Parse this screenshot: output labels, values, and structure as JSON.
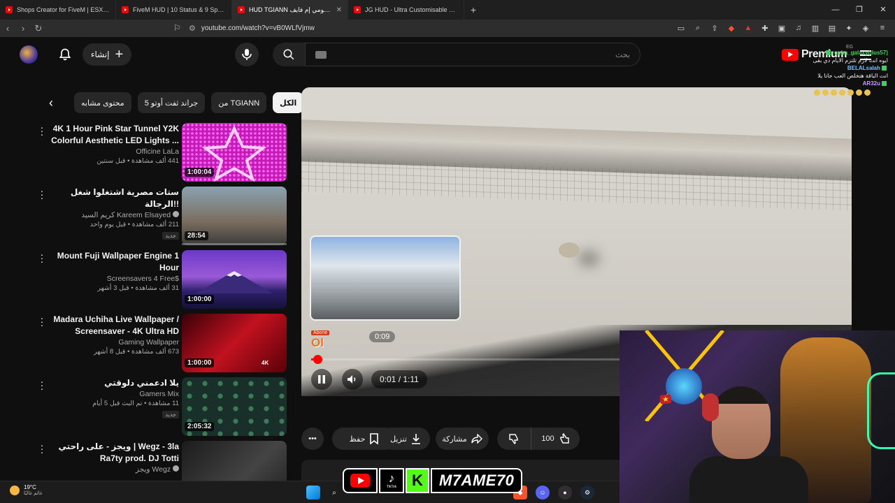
{
  "browser": {
    "tabs": [
      {
        "title": "Shops Creator for FiveM | ESX, Qbox..."
      },
      {
        "title": "FiveM HUD | 10 Status & 9 Speed..."
      },
      {
        "title": "HUD TGIANN لومي إم فايف - YouTube"
      },
      {
        "title": "JG HUD - Ultra Customisable & Vehic..."
      }
    ],
    "url": "youtube.com/watch?v=vB0WLfVjmw"
  },
  "header": {
    "create_label": "إنشاء",
    "search_placeholder": "بحث",
    "logo_word": "Premium",
    "region": "EG"
  },
  "chat": [
    {
      "name": "rouba_galaxy(dus57)",
      "msg": "",
      "color": "#3bd35a"
    },
    {
      "name": "",
      "msg": "ايوه انت لازم تلتزم الايام دي بقى",
      "color": "#ffffff"
    },
    {
      "name": "BELALsalah",
      "msg": "",
      "color": "#6ec1ff"
    },
    {
      "name": "",
      "msg": "انت الباقة هتخلص العب جاتا يلا",
      "color": "#ffffff"
    },
    {
      "name": "AR32u",
      "msg": "",
      "color": "#c59cff"
    }
  ],
  "chips": [
    "محتوى مشابه",
    "جراند ثفت أوتو 5",
    "من TGIANN",
    "الكل"
  ],
  "videos": [
    {
      "title": "4K 1 Hour Pink Star Tunnel Y2K Colorful Aesthetic LED Lights ...",
      "channel": "Officine LaLa",
      "stats": "441 ألف مشاهدة • قبل سنتين",
      "duration": "1:00:04",
      "badge": ""
    },
    {
      "title": "ستات مصرية اشتغلوا شغل الرجالة!!",
      "channel": "كريم السيد Kareem Elsayed",
      "stats": "211 ألف مشاهدة • قبل يوم واحد",
      "duration": "28:54",
      "badge": "جديد"
    },
    {
      "title": "Mount Fuji Wallpaper Engine 1 Hour",
      "channel": "Screensavers 4 Free$",
      "stats": "31 ألف مشاهدة • قبل 3 أشهر",
      "duration": "1:00:00",
      "badge": ""
    },
    {
      "title": "Madara Uchiha Live Wallpaper / Screensaver - 4K Ultra HD",
      "channel": "Gaming Wallpaper",
      "stats": "673 ألف مشاهدة • قبل 8 أشهر",
      "duration": "1:00:00",
      "badge": "",
      "quality": "4K"
    },
    {
      "title": "يلا ادعمني دلوقتي",
      "channel": "Gamers Mix",
      "stats": "11 مشاهدة • تم البث قبل 5 أيام",
      "duration": "2:05:32",
      "badge": "جديد"
    },
    {
      "title": "ويجز - على راحتي | Wegz - 3la Ra7ty prod. DJ Totti",
      "channel": "ويجز Wegz",
      "stats": "",
      "duration": "",
      "badge": ""
    }
  ],
  "player": {
    "preview_time": "0:09",
    "current_time": "0:01",
    "duration": "1:11",
    "time_label": "0:01 / 1:11",
    "progress_fraction": 0.014,
    "abone_top": "Abone",
    "abone_bottom": "Ol"
  },
  "actions": {
    "likes": "100",
    "share": "مشاركة",
    "download": "تنزيل",
    "save": "حفظ"
  },
  "taskbar": {
    "temp": "19°C",
    "weather_text": "غائم غالبًا"
  },
  "social": {
    "tiktok_label": "TikTok",
    "kick_letter": "K",
    "handle": "M7AME70"
  }
}
